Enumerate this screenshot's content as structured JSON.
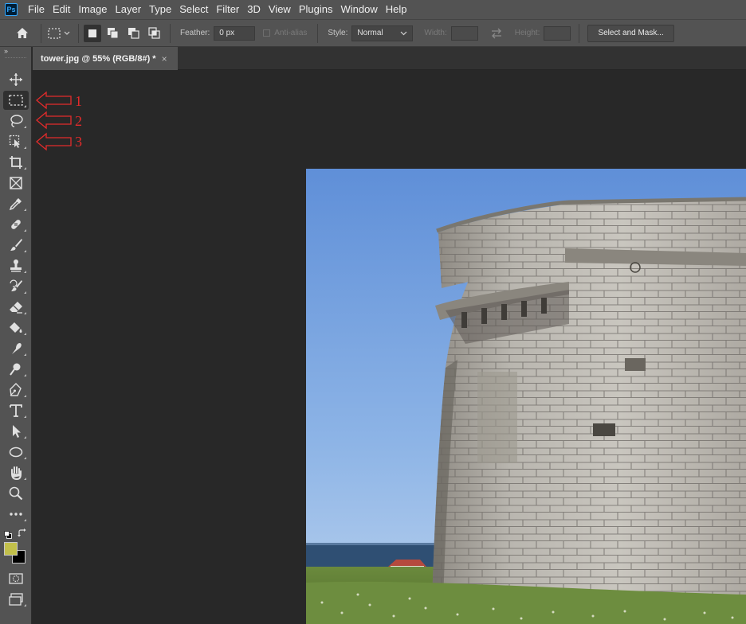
{
  "app": {
    "logo_text": "Ps"
  },
  "menu": [
    "File",
    "Edit",
    "Image",
    "Layer",
    "Type",
    "Select",
    "Filter",
    "3D",
    "View",
    "Plugins",
    "Window",
    "Help"
  ],
  "options": {
    "feather_label": "Feather:",
    "feather_value": "0 px",
    "antialias_label": "Anti-alias",
    "style_label": "Style:",
    "style_value": "Normal",
    "width_label": "Width:",
    "height_label": "Height:",
    "select_mask_label": "Select and Mask..."
  },
  "toolbar": {
    "collapse_glyph": "»",
    "tools": [
      "move-tool",
      "rectangular-marquee-tool",
      "lasso-tool",
      "object-selection-tool",
      "crop-tool",
      "frame-tool",
      "eyedropper-tool",
      "spot-healing-brush-tool",
      "brush-tool",
      "clone-stamp-tool",
      "history-brush-tool",
      "eraser-tool",
      "paint-bucket-tool",
      "smudge-tool",
      "dodge-tool",
      "pen-tool",
      "type-tool",
      "path-selection-tool",
      "ellipse-tool",
      "hand-tool",
      "zoom-tool",
      "edit-toolbar"
    ],
    "foreground_color": "#c2c04b",
    "background_color": "#000000"
  },
  "document": {
    "tab_label": "tower.jpg @ 55% (RGB/8#) *",
    "close_glyph": "×"
  },
  "annotations": {
    "a1": "1",
    "a2": "2",
    "a3": "3",
    "color": "#e32b2b"
  }
}
